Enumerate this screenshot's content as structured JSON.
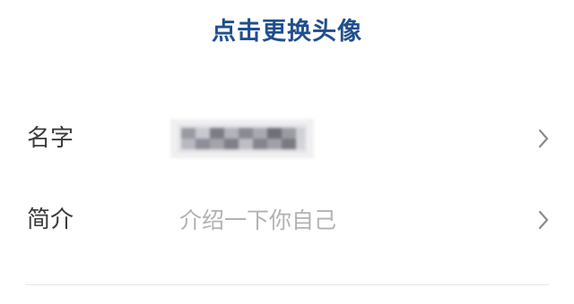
{
  "header": {
    "change_avatar_label": "点击更换头像"
  },
  "profile": {
    "name": {
      "label": "名字",
      "value_visibility": "pixelated"
    },
    "bio": {
      "label": "简介",
      "placeholder": "介绍一下你自己"
    }
  },
  "icons": {
    "row_chevron": "chevron-right-icon"
  },
  "colors": {
    "accent": "#1f4f8e",
    "label_text": "#3a3a3a",
    "placeholder_text": "#b2b2b2",
    "chevron": "#8a8a8a",
    "divider": "#e6e6e6"
  }
}
